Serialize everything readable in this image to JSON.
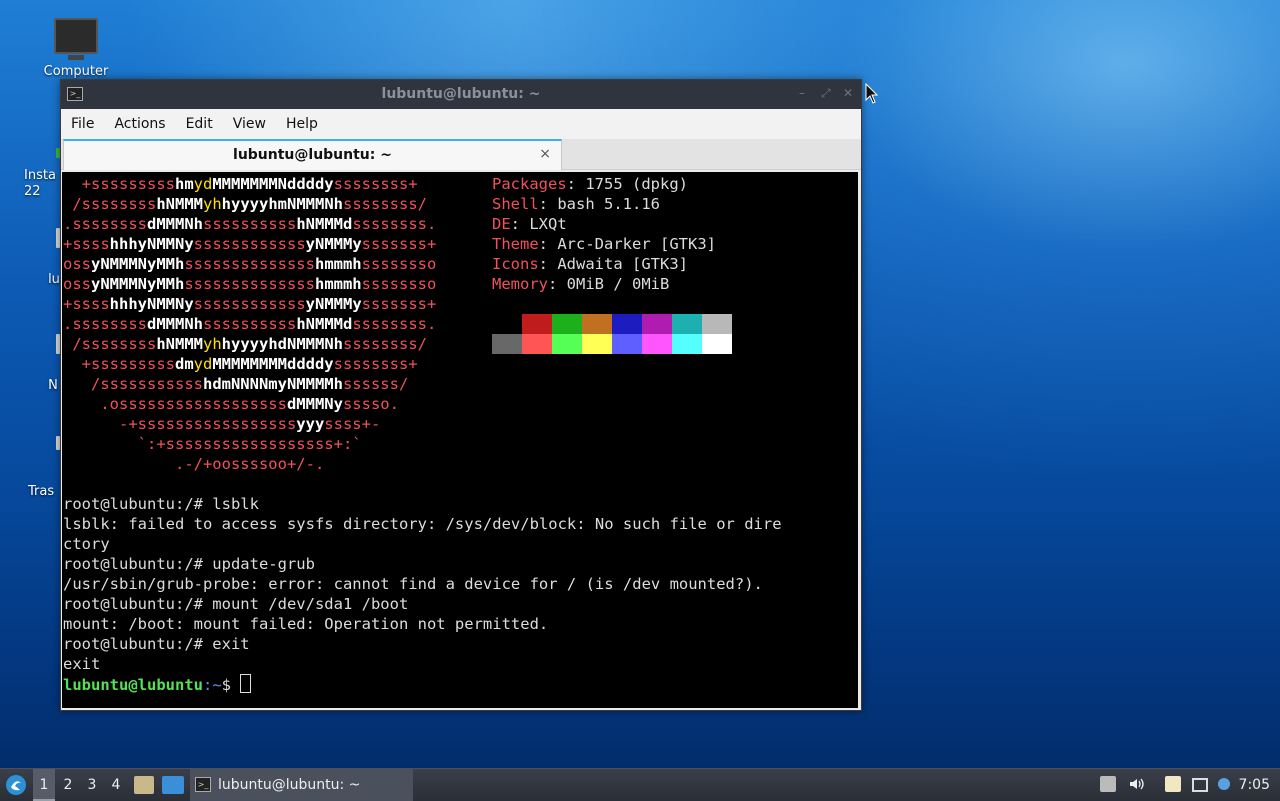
{
  "desktop": {
    "icons": [
      {
        "label": "Computer"
      },
      {
        "label": "Insta\n22"
      },
      {
        "label": "lu"
      },
      {
        "label": "N"
      },
      {
        "label": "Tras"
      }
    ]
  },
  "window": {
    "title": "lubuntu@lubuntu: ~",
    "menu": [
      "File",
      "Actions",
      "Edit",
      "View",
      "Help"
    ],
    "tab_label": "lubuntu@lubuntu: ~",
    "tab_close": "×"
  },
  "terminal": {
    "logo_lines": [
      [
        [
          "r",
          "  +sssssssss"
        ],
        [
          "w",
          "hm"
        ],
        [
          "y",
          "yd"
        ],
        [
          "w",
          "MMMMMMMNddddy"
        ],
        [
          "r",
          "ssssssss+"
        ]
      ],
      [
        [
          "r",
          " /ssssssss"
        ],
        [
          "w",
          "hNMMM"
        ],
        [
          "y",
          "yh"
        ],
        [
          "w",
          "hyyyyhmNMMMNh"
        ],
        [
          "r",
          "ssssssss/"
        ]
      ],
      [
        [
          "r",
          ".ssssssss"
        ],
        [
          "w",
          "dMMMNh"
        ],
        [
          "r",
          "ssssssssss"
        ],
        [
          "w",
          "hNMMMd"
        ],
        [
          "r",
          "ssssssss."
        ]
      ],
      [
        [
          "r",
          "+ssss"
        ],
        [
          "w",
          "hhhyNMMNy"
        ],
        [
          "r",
          "ssssssssssss"
        ],
        [
          "w",
          "yNMMMy"
        ],
        [
          "r",
          "sssssss+"
        ]
      ],
      [
        [
          "r",
          "oss"
        ],
        [
          "w",
          "yNMMMNyMMh"
        ],
        [
          "r",
          "ssssssssssssss"
        ],
        [
          "w",
          "hmmmh"
        ],
        [
          "r",
          "ssssssso"
        ]
      ],
      [
        [
          "r",
          "oss"
        ],
        [
          "w",
          "yNMMMNyMMh"
        ],
        [
          "r",
          "ssssssssssssss"
        ],
        [
          "w",
          "hmmmh"
        ],
        [
          "r",
          "ssssssso"
        ]
      ],
      [
        [
          "r",
          "+ssss"
        ],
        [
          "w",
          "hhhyNMMNy"
        ],
        [
          "r",
          "ssssssssssss"
        ],
        [
          "w",
          "yNMMMy"
        ],
        [
          "r",
          "sssssss+"
        ]
      ],
      [
        [
          "r",
          ".ssssssss"
        ],
        [
          "w",
          "dMMMNh"
        ],
        [
          "r",
          "ssssssssss"
        ],
        [
          "w",
          "hNMMMd"
        ],
        [
          "r",
          "ssssssss."
        ]
      ],
      [
        [
          "r",
          " /ssssssss"
        ],
        [
          "w",
          "hNMMM"
        ],
        [
          "y",
          "yh"
        ],
        [
          "w",
          "hyyyyhdNMMMNh"
        ],
        [
          "r",
          "ssssssss/"
        ]
      ],
      [
        [
          "r",
          "  +sssssssss"
        ],
        [
          "w",
          "dm"
        ],
        [
          "y",
          "yd"
        ],
        [
          "w",
          "MMMMMMMMddddy"
        ],
        [
          "r",
          "ssssssss+"
        ]
      ],
      [
        [
          "r",
          "   /sssssssssss"
        ],
        [
          "w",
          "hdmNNNNmyNMMMMh"
        ],
        [
          "r",
          "ssssss/"
        ]
      ],
      [
        [
          "r",
          "    .ossssssssssssssssss"
        ],
        [
          "w",
          "dMMMNy"
        ],
        [
          "r",
          "sssso."
        ]
      ],
      [
        [
          "r",
          "      -+sssssssssssssssss"
        ],
        [
          "w",
          "yyy"
        ],
        [
          "r",
          "ssss+-"
        ]
      ],
      [
        [
          "r",
          "        `:+ssssssssssssssssss+:`"
        ]
      ],
      [
        [
          "r",
          "            .-/+oossssoo+/-."
        ]
      ]
    ],
    "info": [
      {
        "key": "Packages",
        "value": "1755 (dpkg)"
      },
      {
        "key": "Shell",
        "value": "bash 5.1.16"
      },
      {
        "key": "DE",
        "value": "LXQt"
      },
      {
        "key": "Theme",
        "value": "Arc-Darker [GTK3]"
      },
      {
        "key": "Icons",
        "value": "Adwaita [GTK3]"
      },
      {
        "key": "Memory",
        "value": "0MiB / 0MiB"
      }
    ],
    "palette_top": [
      "#000000",
      "#c01c1c",
      "#1cb01c",
      "#c07020",
      "#1c1cc0",
      "#b01cb0",
      "#1cb0b0",
      "#b8b8b8"
    ],
    "palette_bottom": [
      "#686868",
      "#ff5555",
      "#55ff55",
      "#ffff55",
      "#5f5fff",
      "#ff55ff",
      "#55ffff",
      "#ffffff"
    ],
    "output_lines": [
      "root@lubuntu:/# lsblk",
      "lsblk: failed to access sysfs directory: /sys/dev/block: No such file or dire",
      "ctory",
      "root@lubuntu:/# update-grub",
      "/usr/sbin/grub-probe: error: cannot find a device for / (is /dev mounted?).",
      "root@lubuntu:/# mount /dev/sda1 /boot",
      "mount: /boot: mount failed: Operation not permitted.",
      "root@lubuntu:/# exit",
      "exit"
    ],
    "prompt_user": "lubuntu@lubuntu",
    "prompt_path": ":~",
    "prompt_symbol": "$ "
  },
  "taskbar": {
    "workspaces": [
      "1",
      "2",
      "3",
      "4"
    ],
    "task_label": "lubuntu@lubuntu: ~",
    "clock": "7:05"
  }
}
